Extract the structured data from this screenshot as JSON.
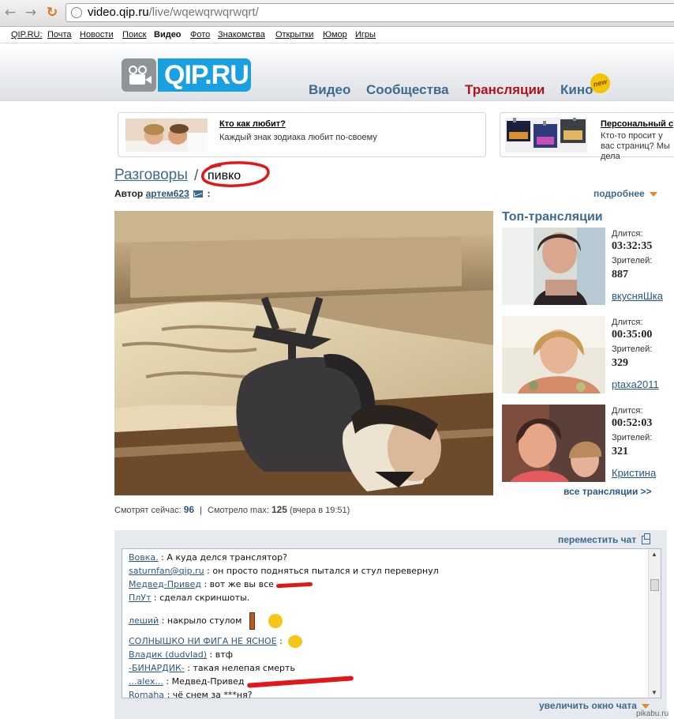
{
  "browser": {
    "url_host": "video.qip.ru",
    "url_path": "/live/wqewqrwqrwqrt/"
  },
  "toplinks": [
    "QIP.RU:",
    "Почта",
    "Новости",
    "Поиск",
    "Видео",
    "Фото",
    "Знакомства",
    "Открытки",
    "Юмор",
    "Игры"
  ],
  "header": {
    "logo_text": "QIP.RU",
    "nav": [
      "Видео",
      "Сообщества",
      "Трансляции",
      "Кино"
    ],
    "badge": "new"
  },
  "promos": [
    {
      "title": "Кто как любит?",
      "desc": "Каждый знак зодиака любит по-своему"
    },
    {
      "title": "Персональный с",
      "desc": "Кто-то просит у вас страниц? Мы дела"
    }
  ],
  "page": {
    "crumb_parent": "Разговоры",
    "crumb_sep": "/",
    "crumb_current": "пивко",
    "author_label": "Автор",
    "author_name": "артем623",
    "author_colon": ":",
    "more": "подробнее"
  },
  "stats": {
    "now_label": "Смотрят сейчас:",
    "now_value": "96",
    "sep": "|",
    "max_label": "Смотрело max:",
    "max_value": "125",
    "max_note": "(вчера в 19:51)"
  },
  "top_streams": {
    "title": "Топ-трансляции",
    "duration_label": "Длится:",
    "viewers_label": "Зрителей:",
    "items": [
      {
        "duration": "03:32:35",
        "viewers": "887",
        "user": "вкусняШка"
      },
      {
        "duration": "00:35:00",
        "viewers": "329",
        "user": "ptaxa2011"
      },
      {
        "duration": "00:52:03",
        "viewers": "321",
        "user": "Кристина"
      }
    ],
    "all_link": "все трансляции >>"
  },
  "chat": {
    "move_label": "переместить чат",
    "enlarge_label": "увеличить окно чата",
    "messages": [
      {
        "who": "Вовка.",
        "text": ": А куда делся транслятор?"
      },
      {
        "who": "saturnfan@qip.ru",
        "text": ": он просто подняться пытался и стул перевернул"
      },
      {
        "who": "Медвед-Привед",
        "text": ": вот же вы все"
      },
      {
        "who": "ПлУт",
        "text": ": сделал скриншоты."
      },
      {
        "who": "леший",
        "text": ": накрыло стулом"
      },
      {
        "who": "СОЛНЫШКО НИ ФИГА НЕ ЯСНОЕ",
        "text": ":"
      },
      {
        "who": "Владик (dudvlad)",
        "text": ": втф"
      },
      {
        "who": "-БИНАРДИК-",
        "text": ": такая нелепая смерть"
      },
      {
        "who": "...alex...",
        "text": ": Медвед-Привед"
      },
      {
        "who": "Romaha",
        "text": ": чё снем за ***ня?"
      }
    ]
  },
  "watermark": "pikabu.ru"
}
